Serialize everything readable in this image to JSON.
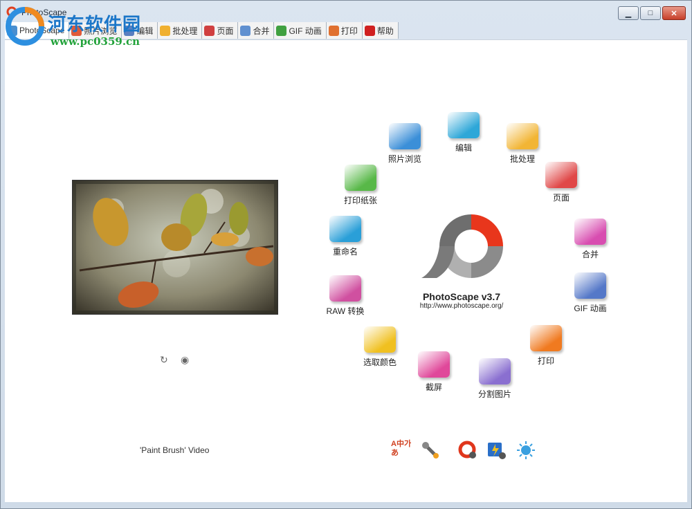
{
  "window": {
    "title": "PhotoScape"
  },
  "watermark": {
    "text": "河东软件园",
    "url": "www.pc0359.cn"
  },
  "tabs": [
    {
      "label": "PhotoScape",
      "color": "#4a8fd0"
    },
    {
      "label": "照片浏览",
      "color": "#e05a3a"
    },
    {
      "label": "编辑",
      "color": "#5a7fc0"
    },
    {
      "label": "批处理",
      "color": "#f0b030"
    },
    {
      "label": "页面",
      "color": "#d04040"
    },
    {
      "label": "合并",
      "color": "#6090d0"
    },
    {
      "label": "GIF 动画",
      "color": "#40a040"
    },
    {
      "label": "打印",
      "color": "#e07030"
    },
    {
      "label": "帮助",
      "color": "#d02020"
    }
  ],
  "preview": {
    "caption": "'Paint Brush' Video",
    "refresh_icon": "refresh-icon",
    "view_icon": "eye-icon"
  },
  "brand": {
    "name": "PhotoScape v3.7",
    "url": "http://www.photoscape.org/"
  },
  "features": [
    {
      "label": "编辑",
      "color": "#2ea7d8",
      "icon": "camera-icon"
    },
    {
      "label": "批处理",
      "color": "#f2b535",
      "icon": "batch-icon"
    },
    {
      "label": "页面",
      "color": "#e04848",
      "icon": "page-icon"
    },
    {
      "label": "合并",
      "color": "#d84db0",
      "icon": "combine-icon"
    },
    {
      "label": "GIF 动画",
      "color": "#5578c8",
      "icon": "gif-icon"
    },
    {
      "label": "打印",
      "color": "#f07a20",
      "icon": "printer-icon"
    },
    {
      "label": "分割图片",
      "color": "#8a6fd0",
      "icon": "splitter-icon"
    },
    {
      "label": "截屏",
      "color": "#e0489a",
      "icon": "screen-capture-icon"
    },
    {
      "label": "选取颜色",
      "color": "#f0c020",
      "icon": "color-picker-icon"
    },
    {
      "label": "RAW 转换",
      "color": "#d050a0",
      "icon": "raw-icon"
    },
    {
      "label": "重命名",
      "color": "#2a9fd8",
      "icon": "rename-icon"
    },
    {
      "label": "打印纸张",
      "color": "#58b848",
      "icon": "paper-icon"
    },
    {
      "label": "照片浏览",
      "color": "#3b8fd8",
      "icon": "viewer-icon"
    }
  ],
  "bottom_tools": [
    {
      "name": "language-icon",
      "text": "A中가あ"
    },
    {
      "name": "tools-icon"
    },
    {
      "name": "photoscape-options-icon"
    },
    {
      "name": "lightning-icon"
    },
    {
      "name": "sun-icon"
    }
  ]
}
